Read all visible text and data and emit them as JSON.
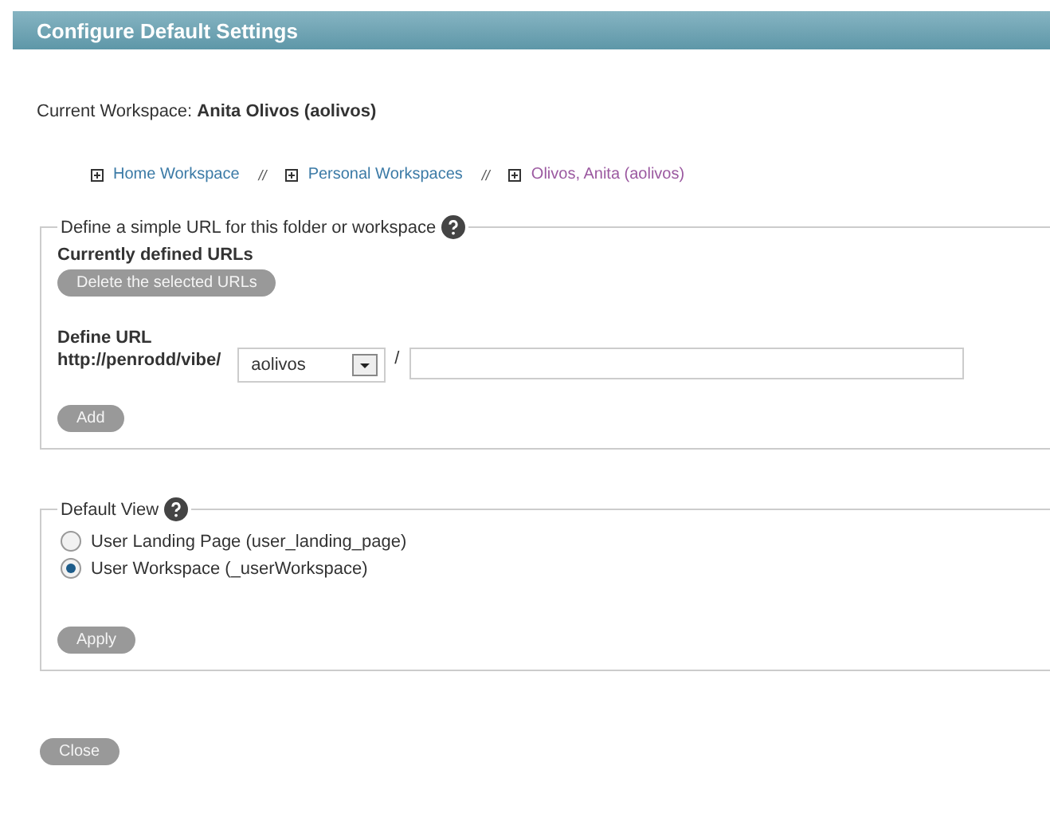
{
  "header": {
    "title": "Configure Default Settings"
  },
  "current_workspace": {
    "label": "Current Workspace:",
    "value": "Anita Olivos (aolivos)"
  },
  "breadcrumb": {
    "separator": "//",
    "items": [
      {
        "label": "Home Workspace",
        "visited": false
      },
      {
        "label": "Personal Workspaces",
        "visited": false
      },
      {
        "label": "Olivos, Anita (aolivos)",
        "visited": true
      }
    ]
  },
  "url_section": {
    "legend": "Define a simple URL for this folder or workspace",
    "defined_heading": "Currently defined URLs",
    "delete_button": "Delete the selected URLs",
    "define_heading": "Define URL",
    "prefix": "http://penrodd/vibe/",
    "select_value": "aolivos",
    "slash": "/",
    "add_button": "Add"
  },
  "default_view": {
    "legend": "Default View",
    "options": [
      {
        "label": "User Landing Page (user_landing_page)",
        "selected": false
      },
      {
        "label": "User Workspace (_userWorkspace)",
        "selected": true
      }
    ],
    "apply_button": "Apply"
  },
  "close_button": "Close"
}
